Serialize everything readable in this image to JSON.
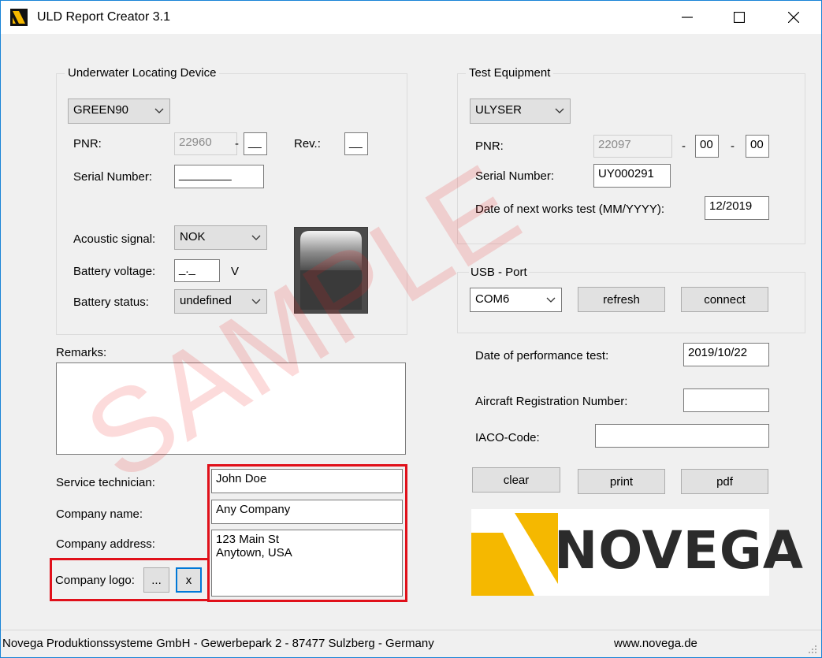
{
  "window": {
    "title": "ULD Report Creator 3.1"
  },
  "uld": {
    "group_title": "Underwater Locating Device",
    "model": "GREEN90",
    "pnr_label": "PNR:",
    "pnr_value": "22960",
    "pnr_dash": "-",
    "pnr_suffix": "__",
    "rev_label": "Rev.:",
    "rev_value": "__",
    "serial_label": "Serial Number:",
    "serial_value": "________",
    "acoustic_label": "Acoustic signal:",
    "acoustic_value": "NOK",
    "battery_voltage_label": "Battery voltage:",
    "battery_voltage_value": "_._",
    "battery_voltage_unit": "V",
    "battery_status_label": "Battery status:",
    "battery_status_value": "undefined"
  },
  "test_equipment": {
    "group_title": "Test Equipment",
    "model": "ULYSER",
    "pnr_label": "PNR:",
    "pnr_value": "22097",
    "dash1": "-",
    "pnr_part2": "00",
    "dash2": "-",
    "pnr_part3": "00",
    "serial_label": "Serial Number:",
    "serial_value": "UY000291",
    "works_test_label": "Date of next works test (MM/YYYY):",
    "works_test_value": "12/2019"
  },
  "usb": {
    "group_title": "USB - Port",
    "port": "COM6",
    "refresh_label": "refresh",
    "connect_label": "connect"
  },
  "report": {
    "remarks_label": "Remarks:",
    "remarks_value": "",
    "performance_label": "Date of performance test:",
    "performance_value": "2019/10/22",
    "aircraft_label": "Aircraft Registration Number:",
    "aircraft_value": "",
    "icao_label": "IACO-Code:",
    "icao_value": ""
  },
  "company": {
    "technician_label": "Service technician:",
    "technician_value": "John Doe",
    "name_label": "Company name:",
    "name_value": "Any Company",
    "address_label": "Company address:",
    "address_value": "123 Main St\nAnytown, USA",
    "logo_label": "Company logo:",
    "browse_label": "...",
    "clear_logo_label": "x"
  },
  "actions": {
    "clear_label": "clear",
    "print_label": "print",
    "pdf_label": "pdf"
  },
  "logo": {
    "brand_text": "NOVEGA",
    "brand_color": "#2b2b2b",
    "accent_color": "#f5b800"
  },
  "watermark_text": "SAMPLE",
  "statusbar": {
    "company_info": "Novega Produktionssysteme GmbH - Gewerbepark 2 - 87477 Sulzberg - Germany",
    "website": "www.novega.de"
  }
}
